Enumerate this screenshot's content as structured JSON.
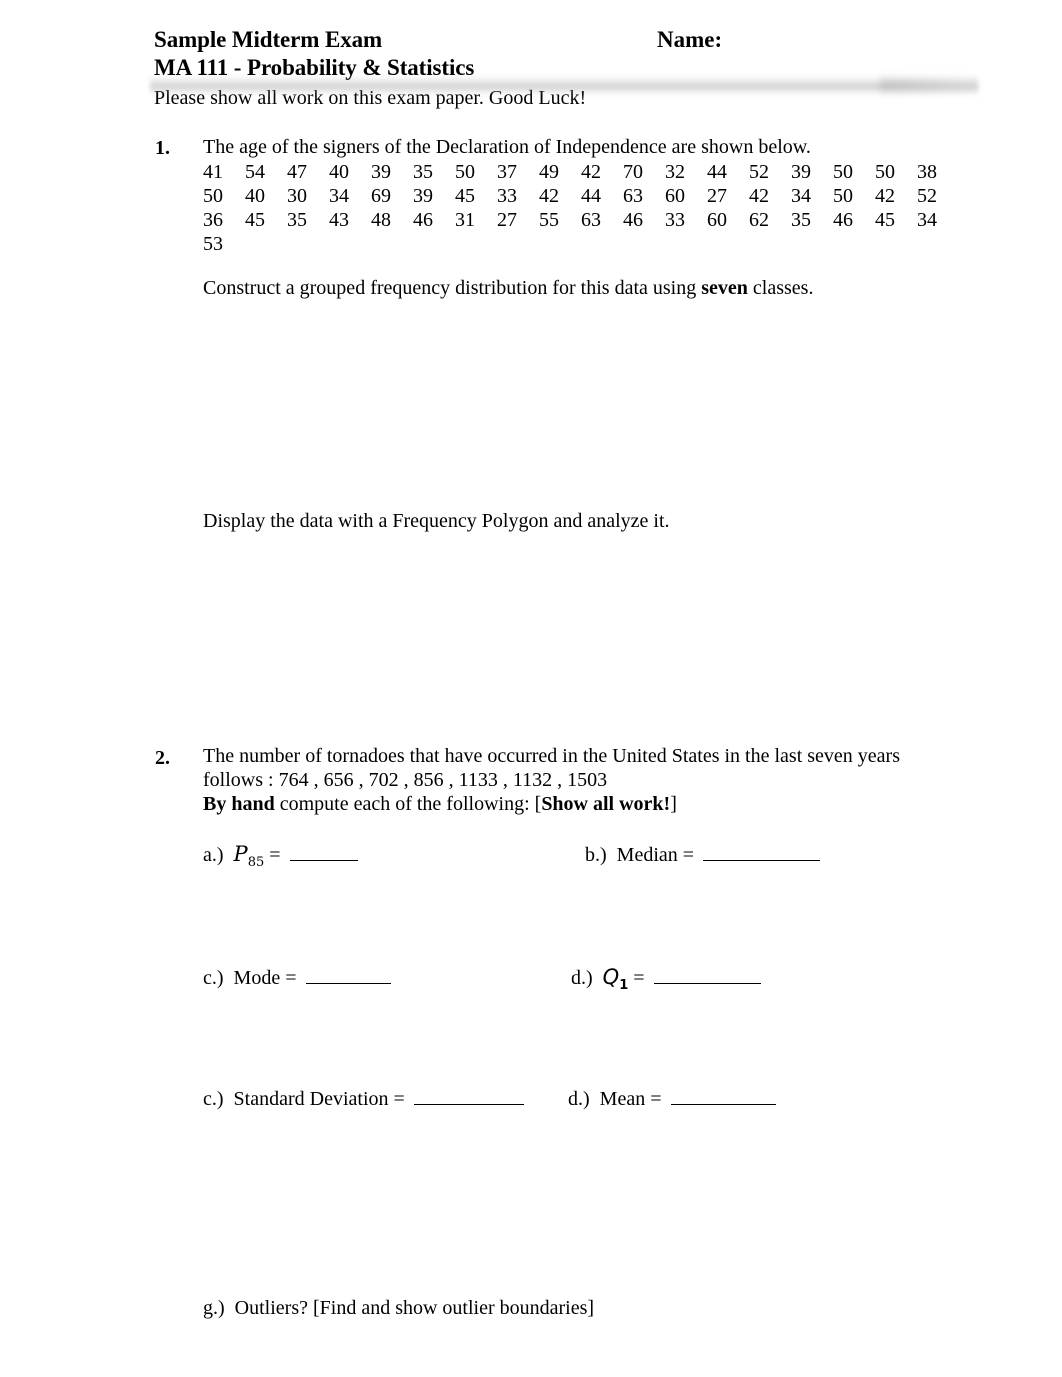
{
  "header": {
    "title": "Sample Midterm Exam",
    "name_label": "Name:",
    "course": "MA 111 - Probability & Statistics",
    "note": "Please show all work on this exam paper.  Good Luck!"
  },
  "questions": [
    {
      "number": "1.",
      "prompt": "The age of the signers of the Declaration of Independence are shown below.",
      "data_rows": [
        [
          "41",
          "54",
          "47",
          "40",
          "39",
          "35",
          "50",
          "37",
          "49",
          "42",
          "70",
          "32",
          "44",
          "52",
          "39",
          "50",
          "50",
          "38"
        ],
        [
          "50",
          "40",
          "30",
          "34",
          "69",
          "39",
          "45",
          "33",
          "42",
          "44",
          "63",
          "60",
          "27",
          "42",
          "34",
          "50",
          "42",
          "52"
        ],
        [
          "36",
          "45",
          "35",
          "43",
          "48",
          "46",
          "31",
          "27",
          "55",
          "63",
          "46",
          "33",
          "60",
          "62",
          "35",
          "46",
          "45",
          "34"
        ],
        [
          "53"
        ]
      ],
      "instruction_a_pre": "Construct a grouped frequency distribution for this data using ",
      "instruction_a_bold": "seven",
      "instruction_a_post": " classes.",
      "instruction_b": "Display the data with a Frequency Polygon and analyze it."
    },
    {
      "number": "2.",
      "prompt_line1": "The number of tornadoes that have occurred in the United States in the last seven years",
      "prompt_line2_pre": "follows :  ",
      "values": "764 ,  656 ,  702 ,  856 ,  1133 ,  1132 ,  1503",
      "instruction_bold1": "By hand",
      "instruction_mid": " compute each of the following: [",
      "instruction_bold2": "Show all work!",
      "instruction_end": "]",
      "parts": [
        {
          "id": "a",
          "label": "a.)",
          "text_html": "P85",
          "symbol": "P",
          "symbol_sub": "85",
          "equals": "="
        },
        {
          "id": "b",
          "label": "b.)",
          "text": "Median ="
        },
        {
          "id": "c",
          "label": "c.)",
          "text": "Mode ="
        },
        {
          "id": "d",
          "label": "d.)",
          "symbol": "Q",
          "symbol_sub": "1",
          "equals": "="
        },
        {
          "id": "e",
          "label": "c.)",
          "text": "Standard Deviation ="
        },
        {
          "id": "f",
          "label": "d.)",
          "text": "Mean ="
        },
        {
          "id": "g",
          "label": "g.)",
          "text": "Outliers? [Find and show outlier boundaries]"
        }
      ]
    }
  ]
}
